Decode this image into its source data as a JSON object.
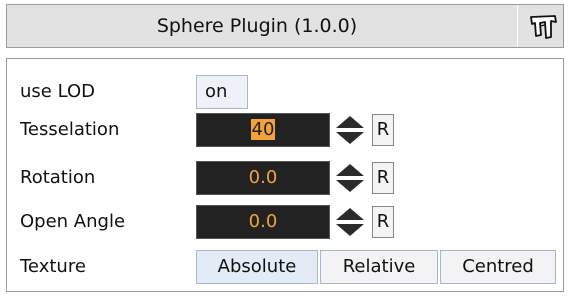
{
  "plugin": {
    "title": "Sphere Plugin (1.0.0)",
    "header_icon": "plugin-icon"
  },
  "rows": {
    "use_lod": {
      "label": "use LOD",
      "value": "on"
    },
    "tesselation": {
      "label": "Tesselation",
      "value": "40",
      "reset_label": "R"
    },
    "rotation": {
      "label": "Rotation",
      "value": "0.0",
      "reset_label": "R"
    },
    "open_angle": {
      "label": "Open Angle",
      "value": "0.0",
      "reset_label": "R"
    },
    "texture": {
      "label": "Texture",
      "options": [
        "Absolute",
        "Relative",
        "Centred"
      ],
      "selected": "Absolute"
    }
  },
  "colors": {
    "field_bg": "#222222",
    "field_text": "#f2a23a"
  }
}
